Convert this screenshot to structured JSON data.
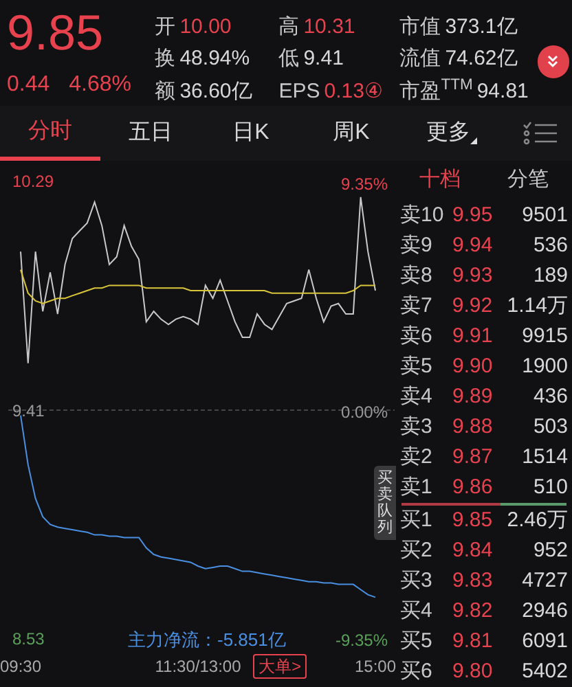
{
  "quote": {
    "price": "9.85",
    "change": "0.44",
    "change_pct": "4.68%"
  },
  "stats": [
    {
      "label": "开",
      "value": "10.00",
      "highlighted": true
    },
    {
      "label": "高",
      "value": "10.31",
      "highlighted": true
    },
    {
      "label": "市值",
      "value": "373.1亿",
      "highlighted": false
    },
    {
      "label": "换",
      "value": "48.94%",
      "highlighted": false
    },
    {
      "label": "低",
      "value": "9.41",
      "highlighted": false
    },
    {
      "label": "流值",
      "value": "74.62亿",
      "highlighted": false
    },
    {
      "label": "额",
      "value": "36.60亿",
      "highlighted": false
    },
    {
      "label": "EPS",
      "value": "0.13④",
      "highlighted": true
    },
    {
      "label": "市盈$^{TTM}$",
      "value": "94.81",
      "highlighted": false
    }
  ],
  "tabs": [
    {
      "label": "分时",
      "selected": true
    },
    {
      "label": "五日",
      "selected": false
    },
    {
      "label": "日K",
      "selected": false
    },
    {
      "label": "周K",
      "selected": false
    },
    {
      "label": "更多",
      "selected": false,
      "kind": "dropdown"
    }
  ],
  "chart": {
    "top_pct": "9.35%",
    "mid_pct": "0.00%",
    "low_pct": "-9.35%",
    "net_flow": "主力净流：-5.851亿",
    "big_order_button": "大单>",
    "queue_tab": "买卖队列",
    "chart_data": {
      "type": "line",
      "ylim": [
        8.53,
        10.29
      ],
      "categories": [
        "09:30",
        null,
        null,
        null,
        null,
        null,
        null,
        null,
        null,
        null,
        null,
        null,
        null,
        null,
        null,
        null,
        null,
        null,
        null,
        null,
        null,
        null,
        null,
        null,
        "11:30/13:00",
        null,
        null,
        null,
        null,
        null,
        null,
        null,
        null,
        null,
        null,
        null,
        null,
        null,
        null,
        null,
        null,
        null,
        null,
        null,
        null,
        null,
        null,
        null,
        "15:00"
      ],
      "yticks": [
        {
          "value": 10.29,
          "label": "10.29"
        },
        {
          "value": 9.41,
          "label": "9.41"
        },
        {
          "value": 8.53,
          "label": "8.53"
        }
      ],
      "series": [
        {
          "color": "#c9c9c9",
          "values": [
            10.02,
            9.59,
            10.02,
            9.79,
            9.94,
            9.78,
            9.97,
            10.07,
            10.1,
            10.13,
            10.21,
            10.12,
            9.97,
            10.0,
            10.12,
            10.04,
            9.99,
            9.75,
            9.79,
            9.76,
            9.74,
            9.76,
            9.77,
            9.76,
            9.74,
            9.89,
            9.84,
            9.91,
            9.83,
            9.75,
            9.69,
            9.69,
            9.78,
            9.74,
            9.72,
            9.77,
            9.82,
            9.83,
            9.84,
            9.95,
            9.84,
            9.75,
            9.81,
            9.82,
            9.78,
            9.78,
            10.23,
            10.02,
            9.87
          ]
        },
        {
          "color": "#d9c53a",
          "values": [
            9.95,
            9.86,
            9.83,
            9.82,
            9.83,
            9.84,
            9.84,
            9.85,
            9.86,
            9.87,
            9.88,
            9.88,
            9.89,
            9.89,
            9.89,
            9.89,
            9.89,
            9.88,
            9.88,
            9.88,
            9.88,
            9.88,
            9.88,
            9.87,
            9.87,
            9.87,
            9.87,
            9.87,
            9.87,
            9.87,
            9.87,
            9.87,
            9.87,
            9.87,
            9.86,
            9.86,
            9.86,
            9.86,
            9.86,
            9.86,
            9.86,
            9.86,
            9.86,
            9.86,
            9.86,
            9.87,
            9.89,
            9.89,
            9.89
          ]
        },
        {
          "color": "#4a90e2",
          "values": [
            9.39,
            9.2,
            9.07,
            9.0,
            8.97,
            8.96,
            8.955,
            8.95,
            8.945,
            8.94,
            8.93,
            8.93,
            8.925,
            8.925,
            8.92,
            8.92,
            8.92,
            8.88,
            8.855,
            8.845,
            8.84,
            8.835,
            8.83,
            8.825,
            8.81,
            8.8,
            8.805,
            8.81,
            8.81,
            8.8,
            8.79,
            8.79,
            8.785,
            8.78,
            8.775,
            8.77,
            8.765,
            8.76,
            8.755,
            8.75,
            8.75,
            8.745,
            8.745,
            8.74,
            8.74,
            8.74,
            8.72,
            8.7,
            8.69
          ]
        }
      ]
    }
  },
  "book_tabs": [
    {
      "label": "十档",
      "selected": true
    },
    {
      "label": "分笔",
      "selected": false
    }
  ],
  "asks": [
    {
      "label": "卖10",
      "price": "9.95",
      "volume": "9501"
    },
    {
      "label": "卖9",
      "price": "9.94",
      "volume": "536"
    },
    {
      "label": "卖8",
      "price": "9.93",
      "volume": "189"
    },
    {
      "label": "卖7",
      "price": "9.92",
      "volume": "1.14万"
    },
    {
      "label": "卖6",
      "price": "9.91",
      "volume": "9915"
    },
    {
      "label": "卖5",
      "price": "9.90",
      "volume": "1900"
    },
    {
      "label": "卖4",
      "price": "9.89",
      "volume": "436"
    },
    {
      "label": "卖3",
      "price": "9.88",
      "volume": "503"
    },
    {
      "label": "卖2",
      "price": "9.87",
      "volume": "1514"
    },
    {
      "label": "卖1",
      "price": "9.86",
      "volume": "510"
    }
  ],
  "bid_ask_bar": {
    "level": 0.6
  },
  "bids": [
    {
      "label": "买1",
      "price": "9.85",
      "volume": "2.46万"
    },
    {
      "label": "买2",
      "price": "9.84",
      "volume": "952"
    },
    {
      "label": "买3",
      "price": "9.83",
      "volume": "4727"
    },
    {
      "label": "买4",
      "price": "9.82",
      "volume": "2946"
    },
    {
      "label": "买5",
      "price": "9.81",
      "volume": "6091"
    },
    {
      "label": "买6",
      "price": "9.80",
      "volume": "5402"
    }
  ]
}
